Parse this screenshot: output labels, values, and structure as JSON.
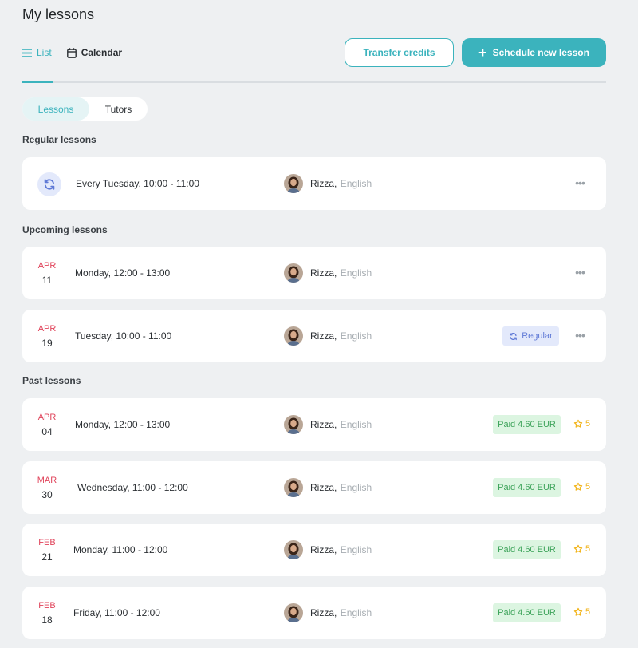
{
  "page": {
    "title": "My lessons"
  },
  "view_tabs": {
    "list_label": "List",
    "calendar_label": "Calendar"
  },
  "actions": {
    "transfer_label": "Transfer credits",
    "schedule_label": "Schedule new lesson",
    "schedule_icon": "+"
  },
  "segments": {
    "lessons_label": "Lessons",
    "tutors_label": "Tutors"
  },
  "sections": {
    "regular": "Regular lessons",
    "upcoming": "Upcoming lessons",
    "past": "Past lessons"
  },
  "more_icon": "•••",
  "regular_lessons": [
    {
      "time": "Every Tuesday, 10:00 - 11:00",
      "tutor": "Rizza,",
      "subject": "English"
    }
  ],
  "upcoming_lessons": [
    {
      "month": "APR",
      "day": "11",
      "time": "Monday, 12:00 - 13:00",
      "tutor": "Rizza,",
      "subject": "English"
    },
    {
      "month": "APR",
      "day": "19",
      "time": "Tuesday, 10:00 - 11:00",
      "tutor": "Rizza,",
      "subject": "English",
      "badge": "Regular"
    }
  ],
  "past_lessons": [
    {
      "month": "APR",
      "day": "04",
      "time": "Monday, 12:00 - 13:00",
      "tutor": "Rizza,",
      "subject": "English",
      "payment": "Paid 4.60 EUR",
      "rating": "5"
    },
    {
      "month": "MAR",
      "day": "30",
      "time": "Wednesday, 11:00 - 12:00",
      "tutor": "Rizza,",
      "subject": "English",
      "payment": "Paid 4.60 EUR",
      "rating": "5"
    },
    {
      "month": "FEB",
      "day": "21",
      "time": "Monday, 11:00 - 12:00",
      "tutor": "Rizza,",
      "subject": "English",
      "payment": "Paid 4.60 EUR",
      "rating": "5"
    },
    {
      "month": "FEB",
      "day": "18",
      "time": "Friday, 11:00 - 12:00",
      "tutor": "Rizza,",
      "subject": "English",
      "payment": "Paid 4.60 EUR",
      "rating": "5"
    }
  ],
  "colors": {
    "accent": "#3bb3bd",
    "month_red": "#e0435a",
    "paid_green": "#3da35a",
    "regular_blue": "#5f79d6",
    "star_yellow": "#f2b51d"
  }
}
